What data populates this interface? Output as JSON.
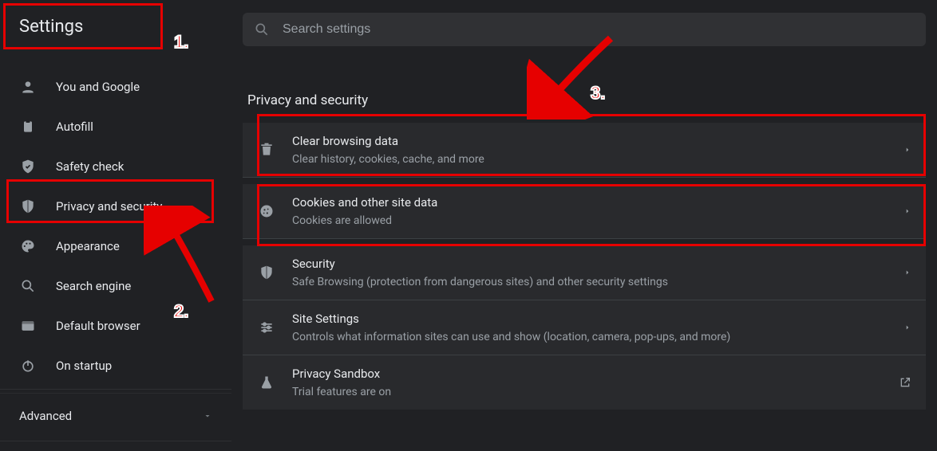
{
  "header": {
    "title": "Settings"
  },
  "search": {
    "placeholder": "Search settings"
  },
  "sidebar": {
    "items": [
      {
        "label": "You and Google"
      },
      {
        "label": "Autofill"
      },
      {
        "label": "Safety check"
      },
      {
        "label": "Privacy and security"
      },
      {
        "label": "Appearance"
      },
      {
        "label": "Search engine"
      },
      {
        "label": "Default browser"
      },
      {
        "label": "On startup"
      }
    ],
    "advanced_label": "Advanced"
  },
  "main": {
    "section_title": "Privacy and security",
    "cards": [
      {
        "title": "Clear browsing data",
        "sub": "Clear history, cookies, cache, and more"
      },
      {
        "title": "Cookies and other site data",
        "sub": "Cookies are allowed"
      },
      {
        "title": "Security",
        "sub": "Safe Browsing (protection from dangerous sites) and other security settings"
      },
      {
        "title": "Site Settings",
        "sub": "Controls what information sites can use and show (location, camera, pop-ups, and more)"
      },
      {
        "title": "Privacy Sandbox",
        "sub": "Trial features are on"
      }
    ]
  },
  "annotations": {
    "n1": "1.",
    "n2": "2.",
    "n3": "3."
  }
}
